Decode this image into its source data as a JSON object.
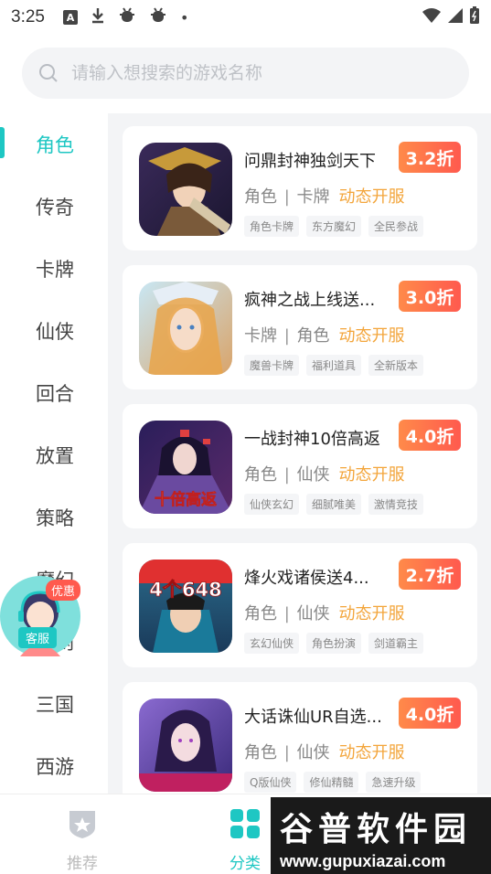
{
  "status_bar": {
    "time": "3:25",
    "notif_a": "A",
    "dot": "•"
  },
  "search": {
    "placeholder": "请输入想搜索的游戏名称"
  },
  "sidebar": {
    "items": [
      {
        "label": "角色",
        "active": true
      },
      {
        "label": "传奇"
      },
      {
        "label": "卡牌"
      },
      {
        "label": "仙侠"
      },
      {
        "label": "回合"
      },
      {
        "label": "放置"
      },
      {
        "label": "策略"
      },
      {
        "label": "魔幻"
      },
      {
        "label": "休闲"
      },
      {
        "label": "三国"
      },
      {
        "label": "西游"
      }
    ]
  },
  "games": [
    {
      "title": "问鼎封神独剑天下",
      "discount": "3.2折",
      "cat1": "角色",
      "cat2": "卡牌",
      "service": "动态开服",
      "tags": [
        "角色卡牌",
        "东方魔幻",
        "全民参战"
      ]
    },
    {
      "title": "疯神之战上线送...",
      "discount": "3.0折",
      "cat1": "卡牌",
      "cat2": "角色",
      "service": "动态开服",
      "tags": [
        "魔兽卡牌",
        "福利道具",
        "全新版本"
      ]
    },
    {
      "title": "一战封神10倍高返",
      "discount": "4.0折",
      "cat1": "角色",
      "cat2": "仙侠",
      "service": "动态开服",
      "tags": [
        "仙侠玄幻",
        "细腻唯美",
        "激情竞技"
      ]
    },
    {
      "title": "烽火戏诸侯送4...",
      "discount": "2.7折",
      "cat1": "角色",
      "cat2": "仙侠",
      "service": "动态开服",
      "tags": [
        "玄幻仙侠",
        "角色扮演",
        "剑道霸主"
      ]
    },
    {
      "title": "大话诛仙UR自选...",
      "discount": "4.0折",
      "cat1": "角色",
      "cat2": "仙侠",
      "service": "动态开服",
      "tags": [
        "Q版仙侠",
        "修仙精髓",
        "急速升级"
      ]
    }
  ],
  "thumb_text": {
    "g3": "十倍高返",
    "g4": "4个648"
  },
  "float_service": {
    "badge": "优惠",
    "label": "客服"
  },
  "bottom_nav": {
    "recommend": "推荐",
    "category": "分类"
  },
  "watermark": {
    "title": "谷普软件园",
    "url": "www.gupuxiazai.com"
  },
  "colors": {
    "accent": "#1ec7c3",
    "discount_start": "#ff8a4a",
    "discount_end": "#ff5a4e",
    "service": "#f3a53b"
  }
}
